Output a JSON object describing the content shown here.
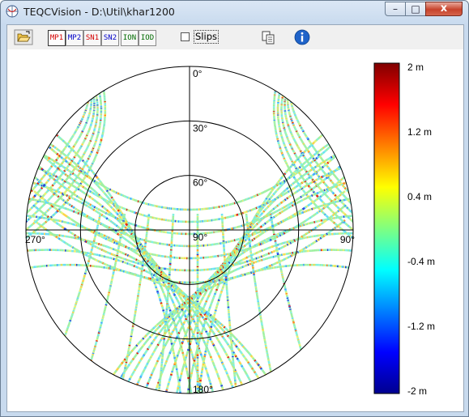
{
  "window": {
    "title": "TEQCVision - D:\\Util\\khar1200",
    "min_label": "–",
    "max_label": "□",
    "close_label": "x"
  },
  "toolbar": {
    "buttons": [
      {
        "label": "MP1",
        "color": "#d40000"
      },
      {
        "label": "MP2",
        "color": "#0000c8"
      },
      {
        "label": "SN1",
        "color": "#d40000"
      },
      {
        "label": "SN2",
        "color": "#0000c8"
      },
      {
        "label": "ION",
        "color": "#006b00"
      },
      {
        "label": "IOD",
        "color": "#006b00"
      }
    ],
    "slips_label": "Slips",
    "slips_checked": false,
    "open_icon": "folder-open-icon",
    "copy_icon": "copy-icon",
    "info_icon": "info-icon"
  },
  "skyplot": {
    "azimuth_labels": {
      "north": "0°",
      "east": "90°",
      "south": "180°",
      "west": "270°"
    },
    "elevation_labels": [
      "30°",
      "60°",
      "90°"
    ],
    "colorbar": {
      "tick_labels": [
        "2 m",
        "1.2 m",
        "0.4 m",
        "-0.4 m",
        "-1.2 m",
        "-2 m"
      ],
      "range": [
        -2,
        2
      ],
      "colors": [
        "#00008f",
        "#0000ff",
        "#0080ff",
        "#00ffff",
        "#80ff80",
        "#ffff00",
        "#ff8000",
        "#ff0000",
        "#800000"
      ]
    }
  }
}
